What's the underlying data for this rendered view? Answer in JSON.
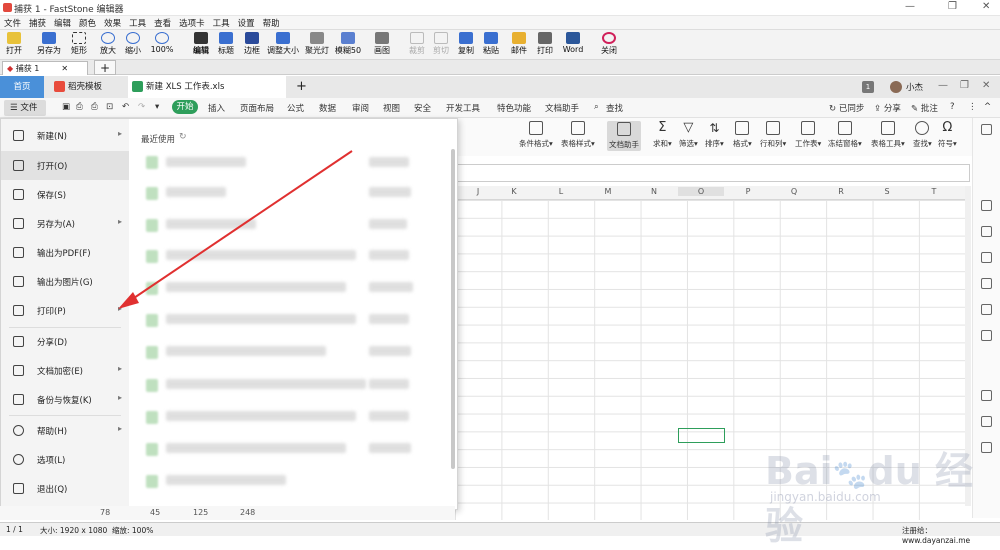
{
  "faststone": {
    "title": "捕获 1 - FastStone 编辑器",
    "menu": [
      "文件",
      "捕获",
      "编辑",
      "颜色",
      "效果",
      "工具",
      "查看",
      "选项卡",
      "工具",
      "设置",
      "帮助"
    ],
    "tools": [
      "打开",
      "另存为",
      "矩形",
      "放大",
      "缩小",
      "100%",
      "编辑",
      "标题",
      "边框",
      "调整大小",
      "聚光灯",
      "模糊50",
      "画图",
      "裁剪",
      "剪切",
      "复制",
      "粘贴",
      "邮件",
      "打印",
      "Word",
      "关闭"
    ],
    "tab": "捕获 1",
    "status": {
      "page": "1 / 1",
      "size": "大小: 1920 x 1080",
      "zoom": "缩放: 100%",
      "reg": "注册给：www.dayanzai.me"
    }
  },
  "wps": {
    "tabs": {
      "home": "首页",
      "template": "稻壳模板",
      "file": "新建 XLS 工作表.xls"
    },
    "user": "小杰",
    "file_menu_button": "文件",
    "ribbon_tabs": [
      "开始",
      "插入",
      "页面布局",
      "公式",
      "数据",
      "审阅",
      "视图",
      "安全",
      "开发工具",
      "特色功能",
      "文档助手"
    ],
    "search": "查找",
    "right_actions": [
      "已同步",
      "分享",
      "批注"
    ],
    "ribbon_tools": [
      "条件格式",
      "表格样式",
      "文档助手",
      "求和",
      "筛选",
      "排序",
      "格式",
      "行和列",
      "工作表",
      "冻结窗格",
      "表格工具",
      "查找",
      "符号"
    ],
    "columns": [
      "J",
      "K",
      "L",
      "M",
      "N",
      "O",
      "P",
      "Q",
      "R",
      "S",
      "T"
    ],
    "file_menu": {
      "items": [
        {
          "label": "新建(N)",
          "arrow": "▸"
        },
        {
          "label": "打开(O)",
          "arrow": ""
        },
        {
          "label": "保存(S)",
          "arrow": ""
        },
        {
          "label": "另存为(A)",
          "arrow": "▸"
        },
        {
          "label": "输出为PDF(F)",
          "arrow": ""
        },
        {
          "label": "输出为图片(G)",
          "arrow": ""
        },
        {
          "label": "打印(P)",
          "arrow": "▸"
        },
        {
          "label": "分享(D)",
          "arrow": ""
        },
        {
          "label": "文档加密(E)",
          "arrow": "▸"
        },
        {
          "label": "备份与恢复(K)",
          "arrow": "▸"
        },
        {
          "label": "帮助(H)",
          "arrow": "▸"
        },
        {
          "label": "选项(L)",
          "arrow": ""
        },
        {
          "label": "退出(Q)",
          "arrow": ""
        }
      ],
      "recent_title": "最近使用"
    },
    "bottom_row": [
      "78",
      "45",
      "125",
      "248"
    ]
  },
  "watermark": {
    "logo": "Bai du 经验",
    "url": "jingyan.baidu.com"
  },
  "colors": {
    "accent": "#2e9e5b",
    "home_tab": "#4a90d9",
    "arrow": "#e03030"
  }
}
